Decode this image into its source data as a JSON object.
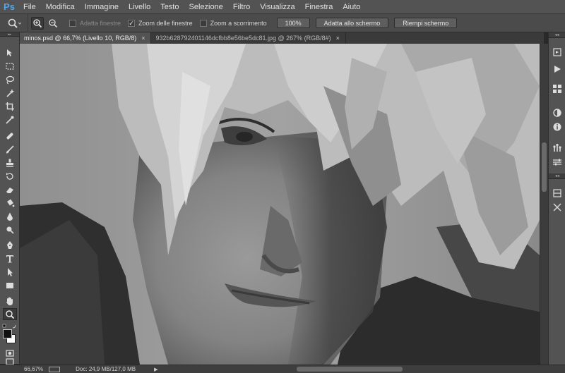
{
  "app": {
    "logo": "Ps"
  },
  "menu": [
    "File",
    "Modifica",
    "Immagine",
    "Livello",
    "Testo",
    "Selezione",
    "Filtro",
    "Visualizza",
    "Finestra",
    "Aiuto"
  ],
  "options": {
    "tool_icon": "zoom-icon",
    "adapt_windows": "Adatta finestre",
    "zoom_windows": "Zoom delle finestre",
    "scrubby_zoom": "Zoom a scorrimento",
    "btn_100": "100%",
    "btn_fit": "Adatta allo schermo",
    "btn_fill": "Riempi schermo",
    "adapt_checked": false,
    "zoom_windows_checked": true,
    "scrubby_checked": false
  },
  "tabs": [
    {
      "label": "minos.psd @ 66,7% (Livello 10, RGB/8)",
      "close": "×",
      "active": true
    },
    {
      "label": "932b628792401146dcfbb8e56be5dc81.jpg @ 267% (RGB/8#)",
      "close": "×",
      "active": false
    }
  ],
  "status": {
    "zoom": "66,67%",
    "doc": "Doc: 24,9 MB/127,0 MB"
  },
  "colors": {
    "foreground": "#111111",
    "background": "#ffffff"
  }
}
